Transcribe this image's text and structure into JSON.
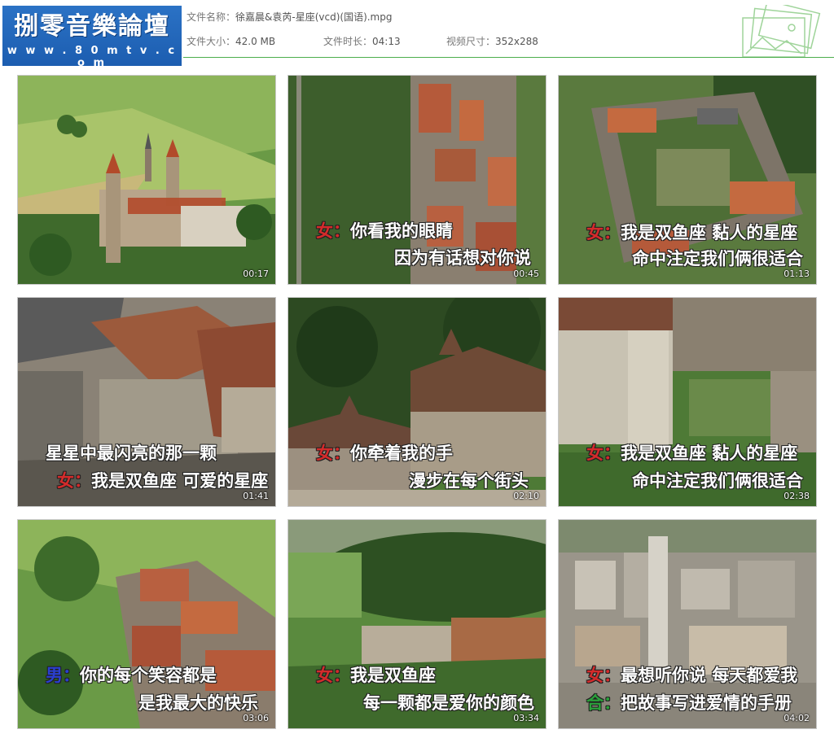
{
  "header": {
    "logo_title": "捌零音樂論壇",
    "logo_url": "w w w . 8 0 m t v . c o m",
    "file_name_label": "文件名称：",
    "file_name": "徐嘉晨&袁芮-星座(vcd)(国语).mpg",
    "file_size_label": "文件大小：",
    "file_size": "42.0 MB",
    "duration_label": "文件时长：",
    "duration": "04:13",
    "video_size_label": "视频尺寸：",
    "video_size": "352x288"
  },
  "thumbnails": [
    {
      "time": "00:17",
      "line1": "",
      "line2": ""
    },
    {
      "time": "00:45",
      "speaker1": "女：",
      "line1": "你看我的眼睛",
      "line2": "因为有话想对你说"
    },
    {
      "time": "01:13",
      "speaker1": "女：",
      "line1": "我是双鱼座 黏人的星座",
      "line2": "命中注定我们俩很适合"
    },
    {
      "time": "01:41",
      "line1": "星星中最闪亮的那一颗",
      "speaker2": "女：",
      "line2": "我是双鱼座 可爱的星座"
    },
    {
      "time": "02:10",
      "speaker1": "女：",
      "line1": "你牵着我的手",
      "line2": "漫步在每个街头"
    },
    {
      "time": "02:38",
      "speaker1": "女：",
      "line1": "我是双鱼座 黏人的星座",
      "line2": "命中注定我们俩很适合"
    },
    {
      "time": "03:06",
      "speaker1": "男：",
      "line1": "你的每个笑容都是",
      "line2": "是我最大的快乐"
    },
    {
      "time": "03:34",
      "speaker1": "女：",
      "line1": "我是双鱼座",
      "line2": "每一颗都是爱你的颜色"
    },
    {
      "time": "04:02",
      "speaker1": "女：",
      "line1": "最想听你说 每天都爱我",
      "speaker2": "合：",
      "line2": "把故事写进爱情的手册"
    }
  ],
  "colors": {
    "logo_bg": "#1c5db0",
    "divider": "#4cae4c",
    "speaker_female": "#d42b2b",
    "speaker_male": "#2a3fd0",
    "speaker_chorus": "#2aa13a"
  }
}
